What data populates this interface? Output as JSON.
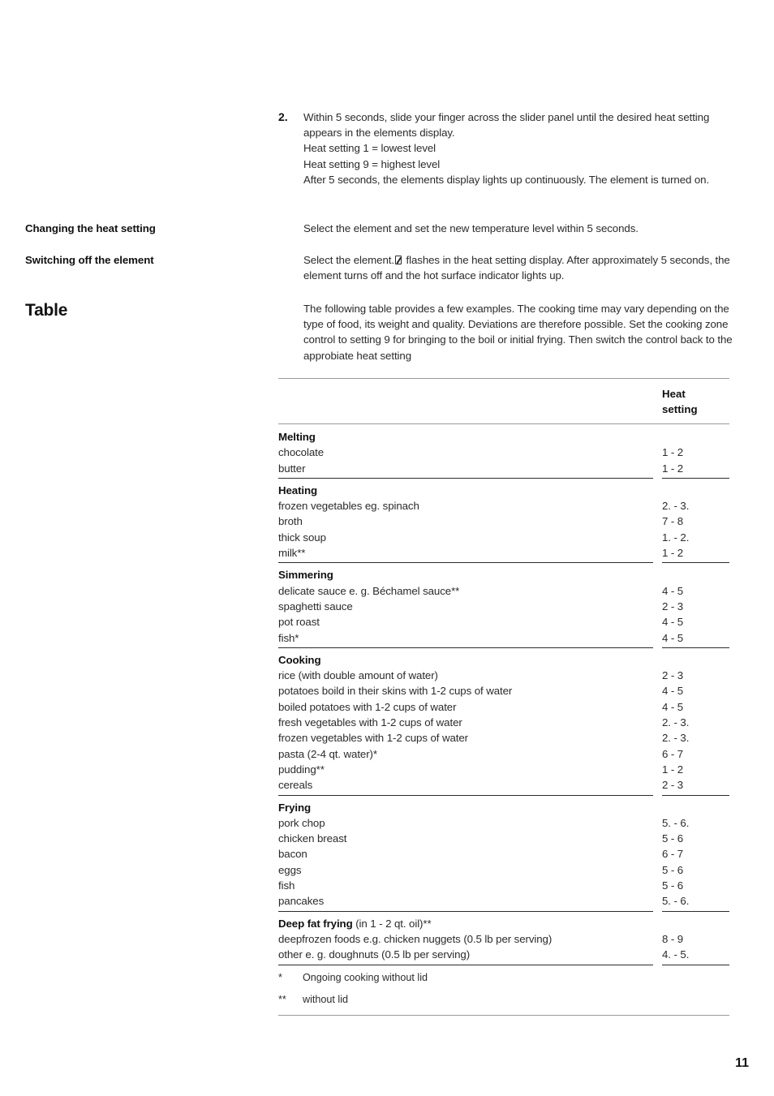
{
  "step": {
    "number": "2.",
    "lines": [
      "Within 5 seconds, slide your finger across the slider panel until the desired heat setting appears in the elements display.",
      "Heat setting 1 = lowest level",
      "Heat setting 9 = highest level",
      "After 5 seconds, the elements display lights up continuously. The element is turned on."
    ]
  },
  "rows": {
    "changing": {
      "label": "Changing the heat setting",
      "text": "Select the element and set the new temperature level within 5 seconds."
    },
    "switching": {
      "label": "Switching off the element",
      "text_before": "Select the element.",
      "glyph": "seven-segment-zero",
      "text_after": "flashes in the heat setting display. After approximately 5 seconds, the element turns off and the hot surface indicator lights up."
    },
    "table": {
      "label": "Table",
      "text": "The following table provides a few examples. The cooking time may vary depending on the type of food, its weight and quality. Deviations are therefore possible. Set the cooking zone control to setting 9 for bringing to the boil or initial frying. Then switch the control back to the approbiate heat setting"
    }
  },
  "table": {
    "header": {
      "item_column": "",
      "heat_line1": "Heat",
      "heat_line2": "setting"
    },
    "groups": [
      {
        "title": "Melting",
        "title_suffix": "",
        "rows": [
          {
            "item": "chocolate",
            "heat": "1 - 2"
          },
          {
            "item": "butter",
            "heat": "1 - 2"
          }
        ]
      },
      {
        "title": "Heating",
        "title_suffix": "",
        "rows": [
          {
            "item": "frozen vegetables eg. spinach",
            "heat": "2. - 3."
          },
          {
            "item": "broth",
            "heat": "7 - 8"
          },
          {
            "item": "thick soup",
            "heat": "1. - 2."
          },
          {
            "item": "milk**",
            "heat": "1 - 2"
          }
        ]
      },
      {
        "title": "Simmering",
        "title_suffix": "",
        "rows": [
          {
            "item": "delicate sauce e. g. Béchamel sauce**",
            "heat": "4 - 5"
          },
          {
            "item": "spaghetti sauce",
            "heat": "2 - 3"
          },
          {
            "item": "pot roast",
            "heat": "4 - 5"
          },
          {
            "item": "fish*",
            "heat": "4 - 5"
          }
        ]
      },
      {
        "title": "Cooking",
        "title_suffix": "",
        "rows": [
          {
            "item": "rice (with double amount of water)",
            "heat": "2 - 3"
          },
          {
            "item": "potatoes boild in their skins with 1-2 cups of water",
            "heat": "4 - 5"
          },
          {
            "item": "boiled potatoes with 1-2 cups of water",
            "heat": "4 - 5"
          },
          {
            "item": "fresh vegetables with 1-2 cups of water",
            "heat": "2. - 3."
          },
          {
            "item": "frozen vegetables with 1-2 cups of water",
            "heat": "2. - 3."
          },
          {
            "item": "pasta (2-4 qt. water)*",
            "heat": "6 - 7"
          },
          {
            "item": "pudding**",
            "heat": "1 - 2"
          },
          {
            "item": "cereals",
            "heat": "2 - 3"
          }
        ]
      },
      {
        "title": "Frying",
        "title_suffix": "",
        "rows": [
          {
            "item": "pork chop",
            "heat": "5. - 6."
          },
          {
            "item": "chicken breast",
            "heat": "5 - 6"
          },
          {
            "item": "bacon",
            "heat": "6 - 7"
          },
          {
            "item": "eggs",
            "heat": "5 - 6"
          },
          {
            "item": "fish",
            "heat": "5 - 6"
          },
          {
            "item": "pancakes",
            "heat": "5. - 6."
          }
        ]
      },
      {
        "title": "Deep fat frying",
        "title_suffix": " (in 1 - 2 qt. oil)**",
        "rows": [
          {
            "item": "deepfrozen foods e.g. chicken nuggets (0.5 lb per serving)",
            "heat": "8 - 9"
          },
          {
            "item": "other e. g. doughnuts (0.5 lb per serving)",
            "heat": "4. - 5."
          }
        ]
      }
    ],
    "footnotes": [
      {
        "mark": "*",
        "text": "Ongoing cooking without lid"
      },
      {
        "mark": "**",
        "text": "without lid"
      }
    ]
  },
  "page_number": "11"
}
